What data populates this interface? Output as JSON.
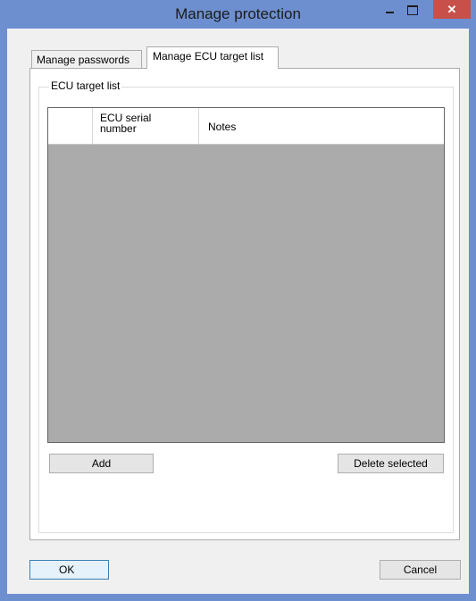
{
  "window": {
    "title": "Manage protection",
    "minimize_icon": "minimize-icon",
    "maximize_icon": "maximize-icon",
    "close_icon": "close-icon",
    "close_glyph": "✕"
  },
  "tabs": [
    {
      "label": "Manage passwords",
      "active": false
    },
    {
      "label": "Manage ECU target list",
      "active": true
    }
  ],
  "group": {
    "label": "ECU target list"
  },
  "grid": {
    "columns": [
      {
        "label": ""
      },
      {
        "label": "ECU serial number"
      },
      {
        "label": "Notes"
      }
    ],
    "rows": []
  },
  "buttons": {
    "add": "Add",
    "delete_selected": "Delete selected",
    "ok": "OK",
    "cancel": "Cancel"
  },
  "colors": {
    "frame": "#6e8fcf",
    "close_button": "#c7504a",
    "grid_background": "#ababab"
  }
}
